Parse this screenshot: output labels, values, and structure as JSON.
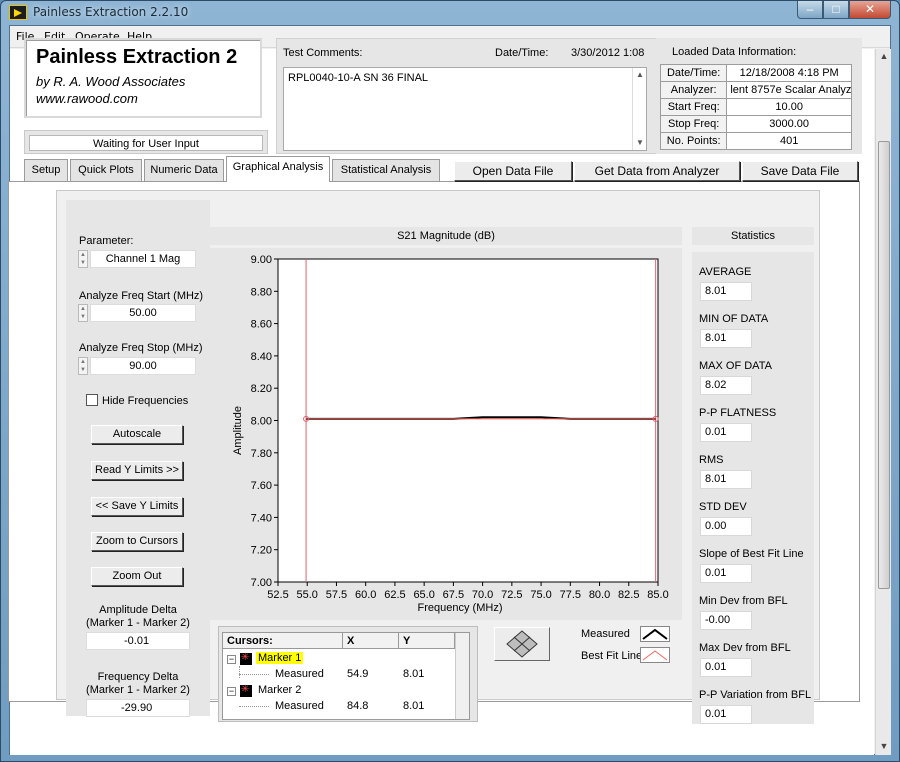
{
  "window": {
    "title": "Painless Extraction 2.2.10"
  },
  "menu": [
    "File",
    "Edit",
    "Operate",
    "Help"
  ],
  "logo": {
    "title": "Painless Extraction 2",
    "line1": "by R. A. Wood Associates",
    "line2": "www.rawood.com"
  },
  "status": "Waiting for User Input",
  "comments": {
    "label": "Test Comments:",
    "datetime_label": "Date/Time:",
    "datetime": "3/30/2012  1:08",
    "text": "RPL0040-10-A SN 36 FINAL"
  },
  "loaded": {
    "label": "Loaded Data Information:",
    "rows": [
      {
        "key": "Date/Time:",
        "value": "12/18/2008 4:18 PM"
      },
      {
        "key": "Analyzer:",
        "value": "lent 8757e Scalar Analyz"
      },
      {
        "key": "Start Freq:",
        "value": "10.00"
      },
      {
        "key": "Stop Freq:",
        "value": "3000.00"
      },
      {
        "key": "No. Points:",
        "value": "401"
      }
    ]
  },
  "tabs": [
    "Setup",
    "Quick Plots",
    "Numeric Data",
    "Graphical Analysis",
    "Statistical Analysis"
  ],
  "active_tab": "Graphical Analysis",
  "actions": {
    "open": "Open Data File",
    "get": "Get Data from Analyzer",
    "save": "Save Data File"
  },
  "controls": {
    "parameter_label": "Parameter:",
    "parameter_value": "Channel 1 Mag",
    "start_label": "Analyze Freq Start (MHz)",
    "start_value": "50.00",
    "stop_label": "Analyze Freq Stop (MHz)",
    "stop_value": "90.00",
    "hide_freq_label": "Hide Frequencies",
    "hide_freq_checked": false,
    "autoscale": "Autoscale",
    "read_y": "Read Y Limits >>",
    "save_y": "<< Save Y Limits",
    "zoom_cursors": "Zoom to Cursors",
    "zoom_out": "Zoom Out",
    "amp_delta_label1": "Amplitude Delta",
    "amp_delta_label2": "(Marker 1 - Marker 2)",
    "amp_delta": "-0.01",
    "freq_delta_label1": "Frequency Delta",
    "freq_delta_label2": "(Marker 1 - Marker 2)",
    "freq_delta": "-29.90"
  },
  "chart_data": {
    "type": "line",
    "title": "S21 Magnitude (dB)",
    "xlabel": "Frequency (MHz)",
    "ylabel": "Amplitude",
    "xlim": [
      52.5,
      85.0
    ],
    "ylim": [
      7.0,
      9.0
    ],
    "xticks": [
      "52.5",
      "55.0",
      "57.5",
      "60.0",
      "62.5",
      "65.0",
      "67.5",
      "70.0",
      "72.5",
      "75.0",
      "77.5",
      "80.0",
      "82.5",
      "85.0"
    ],
    "yticks": [
      "9.00",
      "8.80",
      "8.60",
      "8.40",
      "8.20",
      "8.00",
      "7.80",
      "7.60",
      "7.40",
      "7.20",
      "7.00"
    ],
    "grid": true,
    "series": [
      {
        "name": "Measured",
        "color": "#000000",
        "x": [
          54.9,
          57.5,
          60.0,
          62.5,
          65.0,
          67.5,
          70.0,
          72.5,
          75.0,
          77.5,
          80.0,
          82.5,
          84.8
        ],
        "y": [
          8.01,
          8.01,
          8.01,
          8.01,
          8.01,
          8.01,
          8.02,
          8.02,
          8.02,
          8.01,
          8.01,
          8.01,
          8.01
        ]
      },
      {
        "name": "Best Fit Line",
        "color": "#ff6666",
        "x": [
          54.9,
          84.8
        ],
        "y": [
          8.01,
          8.01
        ]
      }
    ],
    "cursor_lines_x": [
      54.9,
      84.8
    ]
  },
  "cursors": {
    "headers": [
      "Cursors:",
      "X",
      "Y"
    ],
    "rows": [
      {
        "name": "Marker 1",
        "trace": "Measured",
        "x": "54.9",
        "y": "8.01"
      },
      {
        "name": "Marker 2",
        "trace": "Measured",
        "x": "84.8",
        "y": "8.01"
      }
    ]
  },
  "legend": [
    {
      "name": "Measured",
      "color": "#000000"
    },
    {
      "name": "Best Fit Line",
      "color": "#ff6666"
    }
  ],
  "stats": {
    "title": "Statistics",
    "items": [
      {
        "label": "AVERAGE",
        "value": "8.01"
      },
      {
        "label": "MIN OF DATA",
        "value": "8.01"
      },
      {
        "label": "MAX OF DATA",
        "value": "8.02"
      },
      {
        "label": "P-P FLATNESS",
        "value": "0.01"
      },
      {
        "label": "RMS",
        "value": "8.01"
      },
      {
        "label": "STD DEV",
        "value": "0.00"
      },
      {
        "label": "Slope of Best Fit Line",
        "value": "0.01"
      },
      {
        "label": "Min Dev from BFL",
        "value": "-0.00"
      },
      {
        "label": "Max Dev from BFL",
        "value": "0.01"
      },
      {
        "label": "P-P Variation from BFL",
        "value": "0.01"
      }
    ]
  }
}
